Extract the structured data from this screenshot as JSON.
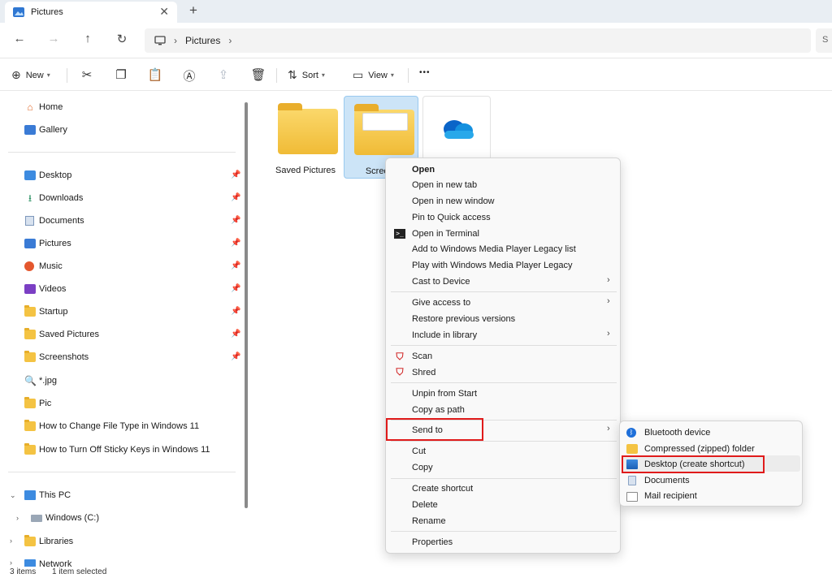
{
  "window": {
    "tab_title": "Pictures",
    "close_glyph": "✕",
    "new_tab_glyph": "+"
  },
  "address": {
    "crumbs": [
      "Pictures"
    ],
    "search_hint": "S"
  },
  "toolbar": {
    "new_label": "New",
    "sort_label": "Sort",
    "view_label": "View",
    "more_glyph": "•••"
  },
  "sidebar": {
    "quick": [
      {
        "label": "Home",
        "icon": "home-icon"
      },
      {
        "label": "Gallery",
        "icon": "gallery-icon"
      }
    ],
    "pinned": [
      {
        "label": "Desktop",
        "icon": "desktop-icon",
        "pinned": true
      },
      {
        "label": "Downloads",
        "icon": "downloads-icon",
        "pinned": true
      },
      {
        "label": "Documents",
        "icon": "documents-icon",
        "pinned": true
      },
      {
        "label": "Pictures",
        "icon": "pictures-icon",
        "pinned": true
      },
      {
        "label": "Music",
        "icon": "music-icon",
        "pinned": true
      },
      {
        "label": "Videos",
        "icon": "videos-icon",
        "pinned": true
      },
      {
        "label": "Startup",
        "icon": "folder-icon",
        "pinned": true
      },
      {
        "label": "Saved Pictures",
        "icon": "folder-icon",
        "pinned": true
      },
      {
        "label": "Screenshots",
        "icon": "folder-icon",
        "pinned": true
      },
      {
        "label": "*.jpg",
        "icon": "search-icon",
        "pinned": false
      },
      {
        "label": "Pic",
        "icon": "folder-icon",
        "pinned": false
      },
      {
        "label": "How to Change File Type in Windows 11",
        "icon": "folder-icon",
        "pinned": false
      },
      {
        "label": "How to Turn Off Sticky Keys in Windows 11",
        "icon": "folder-icon",
        "pinned": false
      }
    ],
    "tree": [
      {
        "label": "This PC",
        "expanded": true
      },
      {
        "label": "Windows (C:)",
        "expanded": false
      },
      {
        "label": "Libraries",
        "expanded": false
      },
      {
        "label": "Network",
        "expanded": false
      }
    ]
  },
  "content": {
    "items": [
      {
        "label": "Saved Pictures"
      },
      {
        "label": "Screens"
      }
    ]
  },
  "status": {
    "count": "3 items",
    "selection": "1 item selected"
  },
  "context_menu": {
    "items": [
      "Open",
      "Open in new tab",
      "Open in new window",
      "Pin to Quick access",
      "Open in Terminal",
      "Add to Windows Media Player Legacy list",
      "Play with Windows Media Player Legacy",
      "Cast to Device",
      "Give access to",
      "Restore previous versions",
      "Include in library",
      "Scan",
      "Shred",
      "Unpin from Start",
      "Copy as path",
      "Send to",
      "Cut",
      "Copy",
      "Create shortcut",
      "Delete",
      "Rename",
      "Properties"
    ],
    "arrow_glyph": "›",
    "highlight_color": "#e01b1b"
  },
  "send_to_menu": {
    "items": [
      "Bluetooth device",
      "Compressed (zipped) folder",
      "Desktop (create shortcut)",
      "Documents",
      "Mail recipient"
    ]
  }
}
